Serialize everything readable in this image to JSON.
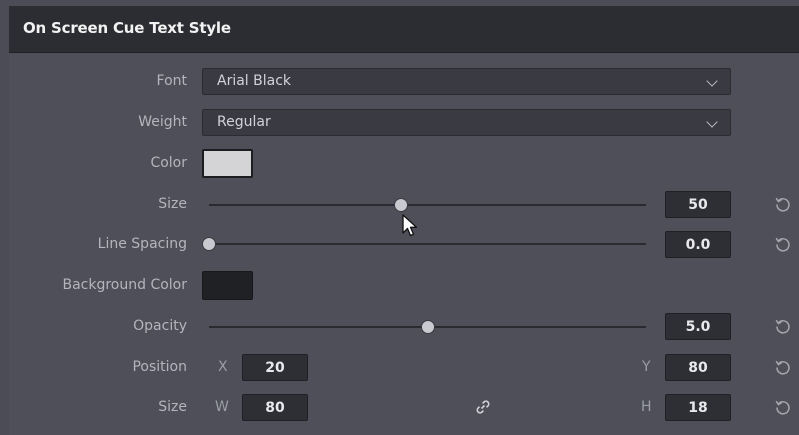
{
  "header": {
    "title": "On Screen Cue Text Style"
  },
  "font": {
    "label": "Font",
    "value": "Arial Black"
  },
  "weight": {
    "label": "Weight",
    "value": "Regular"
  },
  "color": {
    "label": "Color",
    "swatch": "#d4d4d6"
  },
  "size": {
    "label": "Size",
    "value": "50",
    "level": 0.44
  },
  "line_spacing": {
    "label": "Line Spacing",
    "value": "0.0",
    "level": 0.0
  },
  "background_color": {
    "label": "Background Color",
    "swatch": "#1f2124"
  },
  "opacity": {
    "label": "Opacity",
    "value": "5.0",
    "level": 0.5
  },
  "position": {
    "label": "Position",
    "x_label": "X",
    "x_value": "20",
    "y_label": "Y",
    "y_value": "80"
  },
  "dimensions": {
    "label": "Size",
    "w_label": "W",
    "w_value": "80",
    "h_label": "H",
    "h_value": "18"
  },
  "icons": {
    "reset": "reset-icon",
    "link": "link-icon",
    "chevron": "chevron-down-icon",
    "cursor": "mouse-cursor-icon"
  }
}
